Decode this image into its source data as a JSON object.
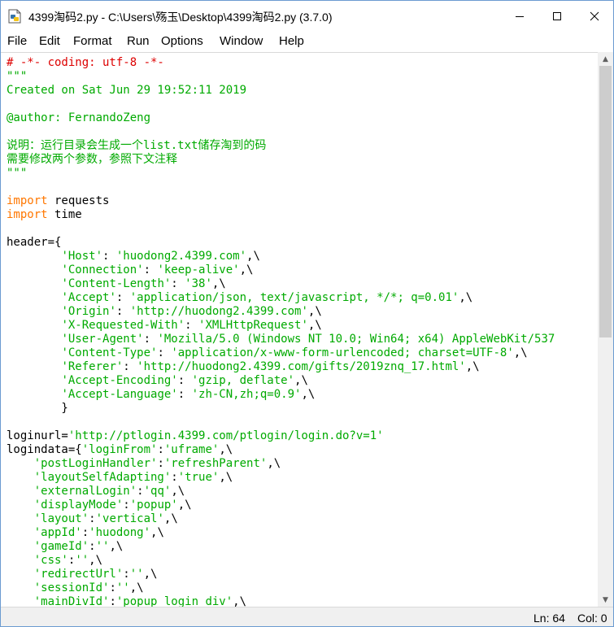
{
  "window": {
    "title": "4399淘码2.py - C:\\Users\\殇玉\\Desktop\\4399淘码2.py (3.7.0)",
    "icon": "python-file-icon"
  },
  "menu": [
    {
      "label": "File"
    },
    {
      "label": "Edit"
    },
    {
      "label": "Format"
    },
    {
      "label": "Run"
    },
    {
      "label": "Options"
    },
    {
      "label": "Window"
    },
    {
      "label": "Help"
    }
  ],
  "code_lines": [
    [
      {
        "t": "c",
        "v": "# -*- coding: utf-8 -*-"
      }
    ],
    [
      {
        "t": "s",
        "v": "\"\"\""
      }
    ],
    [
      {
        "t": "s",
        "v": "Created on Sat Jun 29 19:52:11 2019"
      }
    ],
    [],
    [
      {
        "t": "s",
        "v": "@author: FernandoZeng"
      }
    ],
    [],
    [
      {
        "t": "s",
        "v": "说明：运行目录会生成一个list.txt储存淘到的码"
      }
    ],
    [
      {
        "t": "s",
        "v": "需要修改两个参数，参照下文注释"
      }
    ],
    [
      {
        "t": "s",
        "v": "\"\"\""
      }
    ],
    [],
    [
      {
        "t": "k",
        "v": "import"
      },
      {
        "t": "n",
        "v": " requests"
      }
    ],
    [
      {
        "t": "k",
        "v": "import"
      },
      {
        "t": "n",
        "v": " time"
      }
    ],
    [],
    [
      {
        "t": "n",
        "v": "header={"
      }
    ],
    [
      {
        "t": "n",
        "v": "        "
      },
      {
        "t": "s",
        "v": "'Host'"
      },
      {
        "t": "n",
        "v": ": "
      },
      {
        "t": "s",
        "v": "'huodong2.4399.com'"
      },
      {
        "t": "n",
        "v": ",\\"
      }
    ],
    [
      {
        "t": "n",
        "v": "        "
      },
      {
        "t": "s",
        "v": "'Connection'"
      },
      {
        "t": "n",
        "v": ": "
      },
      {
        "t": "s",
        "v": "'keep-alive'"
      },
      {
        "t": "n",
        "v": ",\\"
      }
    ],
    [
      {
        "t": "n",
        "v": "        "
      },
      {
        "t": "s",
        "v": "'Content-Length'"
      },
      {
        "t": "n",
        "v": ": "
      },
      {
        "t": "s",
        "v": "'38'"
      },
      {
        "t": "n",
        "v": ",\\"
      }
    ],
    [
      {
        "t": "n",
        "v": "        "
      },
      {
        "t": "s",
        "v": "'Accept'"
      },
      {
        "t": "n",
        "v": ": "
      },
      {
        "t": "s",
        "v": "'application/json, text/javascript, */*; q=0.01'"
      },
      {
        "t": "n",
        "v": ",\\"
      }
    ],
    [
      {
        "t": "n",
        "v": "        "
      },
      {
        "t": "s",
        "v": "'Origin'"
      },
      {
        "t": "n",
        "v": ": "
      },
      {
        "t": "s",
        "v": "'http://huodong2.4399.com'"
      },
      {
        "t": "n",
        "v": ",\\"
      }
    ],
    [
      {
        "t": "n",
        "v": "        "
      },
      {
        "t": "s",
        "v": "'X-Requested-With'"
      },
      {
        "t": "n",
        "v": ": "
      },
      {
        "t": "s",
        "v": "'XMLHttpRequest'"
      },
      {
        "t": "n",
        "v": ",\\"
      }
    ],
    [
      {
        "t": "n",
        "v": "        "
      },
      {
        "t": "s",
        "v": "'User-Agent'"
      },
      {
        "t": "n",
        "v": ": "
      },
      {
        "t": "s",
        "v": "'Mozilla/5.0 (Windows NT 10.0; Win64; x64) AppleWebKit/537"
      }
    ],
    [
      {
        "t": "n",
        "v": "        "
      },
      {
        "t": "s",
        "v": "'Content-Type'"
      },
      {
        "t": "n",
        "v": ": "
      },
      {
        "t": "s",
        "v": "'application/x-www-form-urlencoded; charset=UTF-8'"
      },
      {
        "t": "n",
        "v": ",\\"
      }
    ],
    [
      {
        "t": "n",
        "v": "        "
      },
      {
        "t": "s",
        "v": "'Referer'"
      },
      {
        "t": "n",
        "v": ": "
      },
      {
        "t": "s",
        "v": "'http://huodong2.4399.com/gifts/2019znq_17.html'"
      },
      {
        "t": "n",
        "v": ",\\"
      }
    ],
    [
      {
        "t": "n",
        "v": "        "
      },
      {
        "t": "s",
        "v": "'Accept-Encoding'"
      },
      {
        "t": "n",
        "v": ": "
      },
      {
        "t": "s",
        "v": "'gzip, deflate'"
      },
      {
        "t": "n",
        "v": ",\\"
      }
    ],
    [
      {
        "t": "n",
        "v": "        "
      },
      {
        "t": "s",
        "v": "'Accept-Language'"
      },
      {
        "t": "n",
        "v": ": "
      },
      {
        "t": "s",
        "v": "'zh-CN,zh;q=0.9'"
      },
      {
        "t": "n",
        "v": ",\\"
      }
    ],
    [
      {
        "t": "n",
        "v": "        }"
      }
    ],
    [],
    [
      {
        "t": "n",
        "v": "loginurl="
      },
      {
        "t": "s",
        "v": "'http://ptlogin.4399.com/ptlogin/login.do?v=1'"
      }
    ],
    [
      {
        "t": "n",
        "v": "logindata={"
      },
      {
        "t": "s",
        "v": "'loginFrom'"
      },
      {
        "t": "n",
        "v": ":"
      },
      {
        "t": "s",
        "v": "'uframe'"
      },
      {
        "t": "n",
        "v": ",\\"
      }
    ],
    [
      {
        "t": "n",
        "v": "    "
      },
      {
        "t": "s",
        "v": "'postLoginHandler'"
      },
      {
        "t": "n",
        "v": ":"
      },
      {
        "t": "s",
        "v": "'refreshParent'"
      },
      {
        "t": "n",
        "v": ",\\"
      }
    ],
    [
      {
        "t": "n",
        "v": "    "
      },
      {
        "t": "s",
        "v": "'layoutSelfAdapting'"
      },
      {
        "t": "n",
        "v": ":"
      },
      {
        "t": "s",
        "v": "'true'"
      },
      {
        "t": "n",
        "v": ",\\"
      }
    ],
    [
      {
        "t": "n",
        "v": "    "
      },
      {
        "t": "s",
        "v": "'externalLogin'"
      },
      {
        "t": "n",
        "v": ":"
      },
      {
        "t": "s",
        "v": "'qq'"
      },
      {
        "t": "n",
        "v": ",\\"
      }
    ],
    [
      {
        "t": "n",
        "v": "    "
      },
      {
        "t": "s",
        "v": "'displayMode'"
      },
      {
        "t": "n",
        "v": ":"
      },
      {
        "t": "s",
        "v": "'popup'"
      },
      {
        "t": "n",
        "v": ",\\"
      }
    ],
    [
      {
        "t": "n",
        "v": "    "
      },
      {
        "t": "s",
        "v": "'layout'"
      },
      {
        "t": "n",
        "v": ":"
      },
      {
        "t": "s",
        "v": "'vertical'"
      },
      {
        "t": "n",
        "v": ",\\"
      }
    ],
    [
      {
        "t": "n",
        "v": "    "
      },
      {
        "t": "s",
        "v": "'appId'"
      },
      {
        "t": "n",
        "v": ":"
      },
      {
        "t": "s",
        "v": "'huodong'"
      },
      {
        "t": "n",
        "v": ",\\"
      }
    ],
    [
      {
        "t": "n",
        "v": "    "
      },
      {
        "t": "s",
        "v": "'gameId'"
      },
      {
        "t": "n",
        "v": ":"
      },
      {
        "t": "s",
        "v": "''"
      },
      {
        "t": "n",
        "v": ",\\"
      }
    ],
    [
      {
        "t": "n",
        "v": "    "
      },
      {
        "t": "s",
        "v": "'css'"
      },
      {
        "t": "n",
        "v": ":"
      },
      {
        "t": "s",
        "v": "''"
      },
      {
        "t": "n",
        "v": ",\\"
      }
    ],
    [
      {
        "t": "n",
        "v": "    "
      },
      {
        "t": "s",
        "v": "'redirectUrl'"
      },
      {
        "t": "n",
        "v": ":"
      },
      {
        "t": "s",
        "v": "''"
      },
      {
        "t": "n",
        "v": ",\\"
      }
    ],
    [
      {
        "t": "n",
        "v": "    "
      },
      {
        "t": "s",
        "v": "'sessionId'"
      },
      {
        "t": "n",
        "v": ":"
      },
      {
        "t": "s",
        "v": "''"
      },
      {
        "t": "n",
        "v": ",\\"
      }
    ],
    [
      {
        "t": "n",
        "v": "    "
      },
      {
        "t": "s",
        "v": "'mainDivId'"
      },
      {
        "t": "n",
        "v": ":"
      },
      {
        "t": "s",
        "v": "'popup_login_div'"
      },
      {
        "t": "n",
        "v": ",\\"
      }
    ]
  ],
  "status": {
    "line": "Ln: 64",
    "col": "Col: 0"
  },
  "colors": {
    "comment": "#dd0000",
    "string": "#00aa00",
    "keyword": "#ff7700",
    "window_border": "#6b9bd1"
  },
  "scrollbar": {
    "thumb_position": 0.0,
    "visible_fraction": 0.5
  }
}
